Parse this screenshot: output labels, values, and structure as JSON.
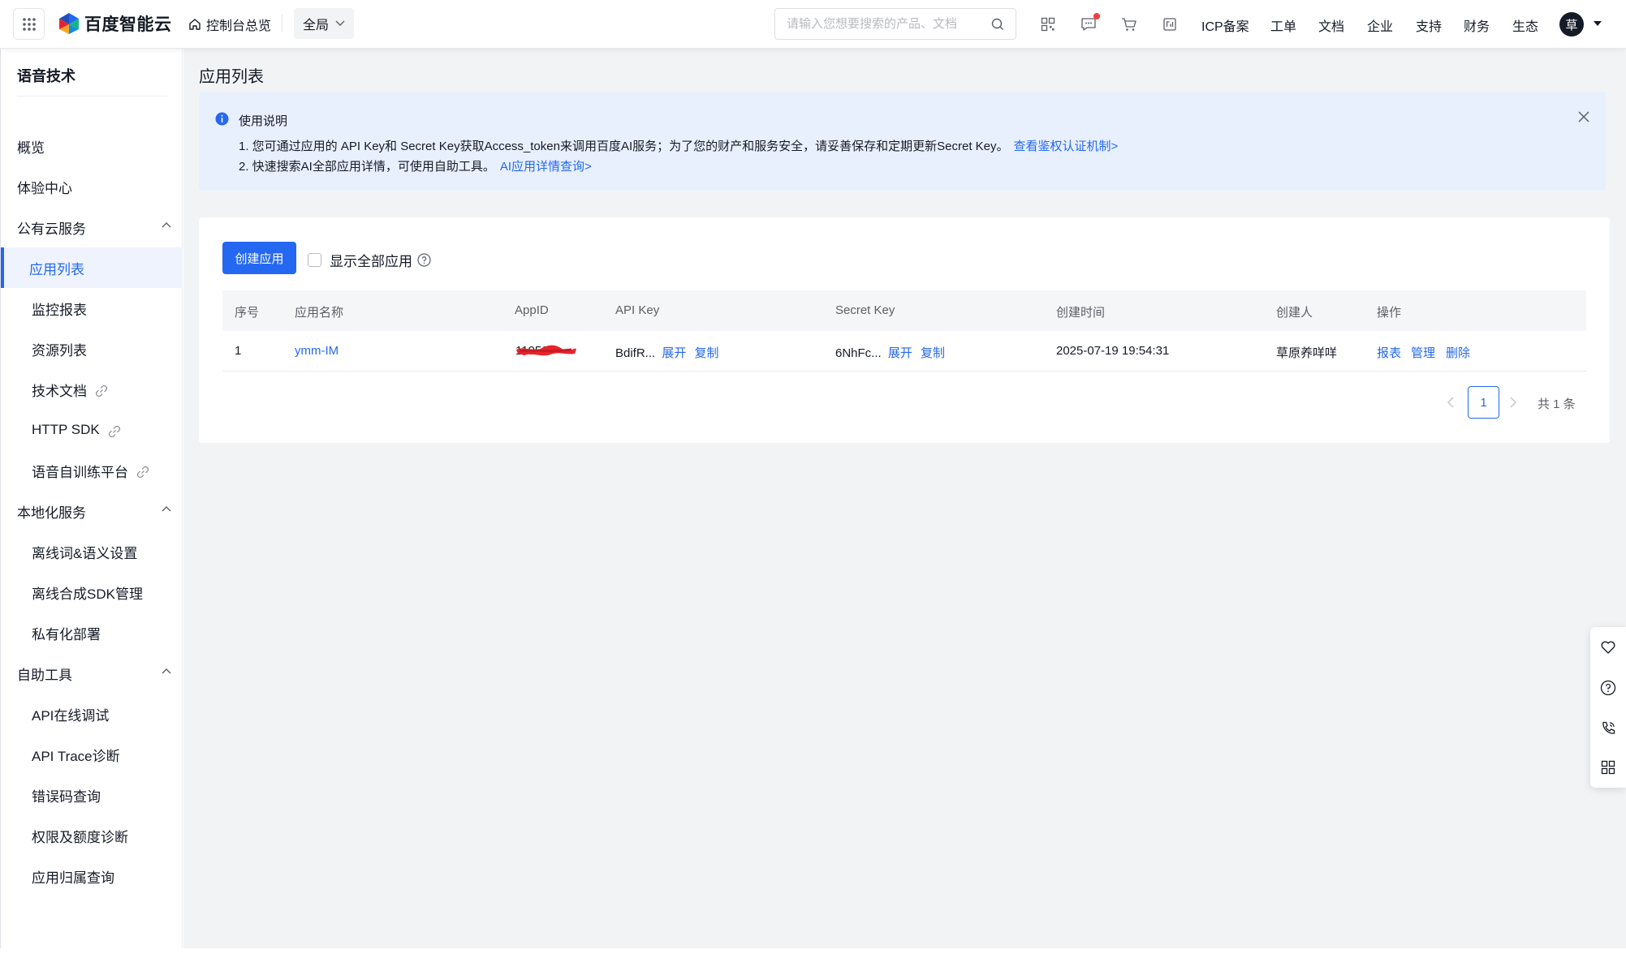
{
  "header": {
    "logo_text": "百度智能云",
    "console_home": "控制台总览",
    "region": "全局",
    "search_placeholder": "请输入您想要搜索的产品、文档",
    "nav": [
      "ICP备案",
      "工单",
      "文档",
      "企业",
      "支持",
      "财务",
      "生态"
    ],
    "avatar_char": "草"
  },
  "sidebar": {
    "title": "语音技术",
    "items": [
      {
        "label": "概览",
        "level": 1
      },
      {
        "label": "体验中心",
        "level": 1
      },
      {
        "label": "公有云服务",
        "level": 1,
        "expandable": true
      },
      {
        "label": "应用列表",
        "level": 2,
        "active": true
      },
      {
        "label": "监控报表",
        "level": 2
      },
      {
        "label": "资源列表",
        "level": 2
      },
      {
        "label": "技术文档",
        "level": 2,
        "external": true
      },
      {
        "label": "HTTP SDK",
        "level": 2,
        "external": true
      },
      {
        "label": "语音自训练平台",
        "level": 2,
        "external": true
      },
      {
        "label": "本地化服务",
        "level": 1,
        "expandable": true
      },
      {
        "label": "离线词&语义设置",
        "level": 2
      },
      {
        "label": "离线合成SDK管理",
        "level": 2
      },
      {
        "label": "私有化部署",
        "level": 2
      },
      {
        "label": "自助工具",
        "level": 1,
        "expandable": true
      },
      {
        "label": "API在线调试",
        "level": 2
      },
      {
        "label": "API Trace诊断",
        "level": 2
      },
      {
        "label": "错误码查询",
        "level": 2
      },
      {
        "label": "权限及额度诊断",
        "level": 2
      },
      {
        "label": "应用归属查询",
        "level": 2
      }
    ]
  },
  "page": {
    "title": "应用列表",
    "notice": {
      "title": "使用说明",
      "line1": "1. 您可通过应用的 API Key和 Secret Key获取Access_token来调用百度AI服务；为了您的财产和服务安全，请妥善保存和定期更新Secret Key。",
      "line1_link": "查看鉴权认证机制>",
      "line2": "2. 快速搜索AI全部应用详情，可使用自助工具。",
      "line2_link": "AI应用详情查询>"
    },
    "create_button": "创建应用",
    "show_all_label": "显示全部应用",
    "table": {
      "columns": [
        "序号",
        "应用名称",
        "AppID",
        "API Key",
        "Secret Key",
        "创建时间",
        "创建人",
        "操作"
      ],
      "rows": [
        {
          "index": "1",
          "name": "ymm-IM",
          "app_id": "11950",
          "api_key": "BdifR...",
          "secret_key": "6NhFc...",
          "created_at": "2025-07-19 19:54:31",
          "creator": "草原养咩咩",
          "expand_label": "展开",
          "copy_label": "复制",
          "actions": [
            "报表",
            "管理",
            "删除"
          ]
        }
      ]
    },
    "pagination": {
      "current": "1",
      "total_text": "共 1 条"
    }
  },
  "colors": {
    "primary": "#2468f2",
    "notice_bg": "#e9f0fd",
    "danger_dot": "#f33e3e",
    "redaction": "#e8232b"
  },
  "icons": [
    "apps-grid-icon",
    "home-icon",
    "chevron-down-icon",
    "search-icon",
    "qrcode-icon",
    "message-icon",
    "cart-icon",
    "finance-icon",
    "info-icon",
    "close-icon",
    "external-link-icon",
    "help-circle-icon",
    "heart-icon",
    "question-icon",
    "phone-icon",
    "grid-icon"
  ]
}
